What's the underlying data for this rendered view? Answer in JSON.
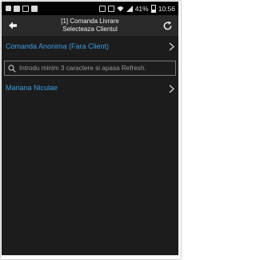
{
  "status_bar": {
    "signal": "41%",
    "time": "10:56"
  },
  "action_bar": {
    "title_line1": "[1] Comanda Livrare",
    "title_line2": "Selecteaza Clientul"
  },
  "anonymous_client": {
    "label": "Comanda Anonima (Fara Client)"
  },
  "search": {
    "value": "",
    "placeholder": "Introdu minim 3 caractere si apasa Refresh."
  },
  "clients": [
    {
      "name": "Mariana Niculae"
    }
  ],
  "colors": {
    "accent": "#3d9be0",
    "background": "#1c1c1c",
    "action_bar": "#2a2a2a",
    "status_bar": "#000000"
  }
}
